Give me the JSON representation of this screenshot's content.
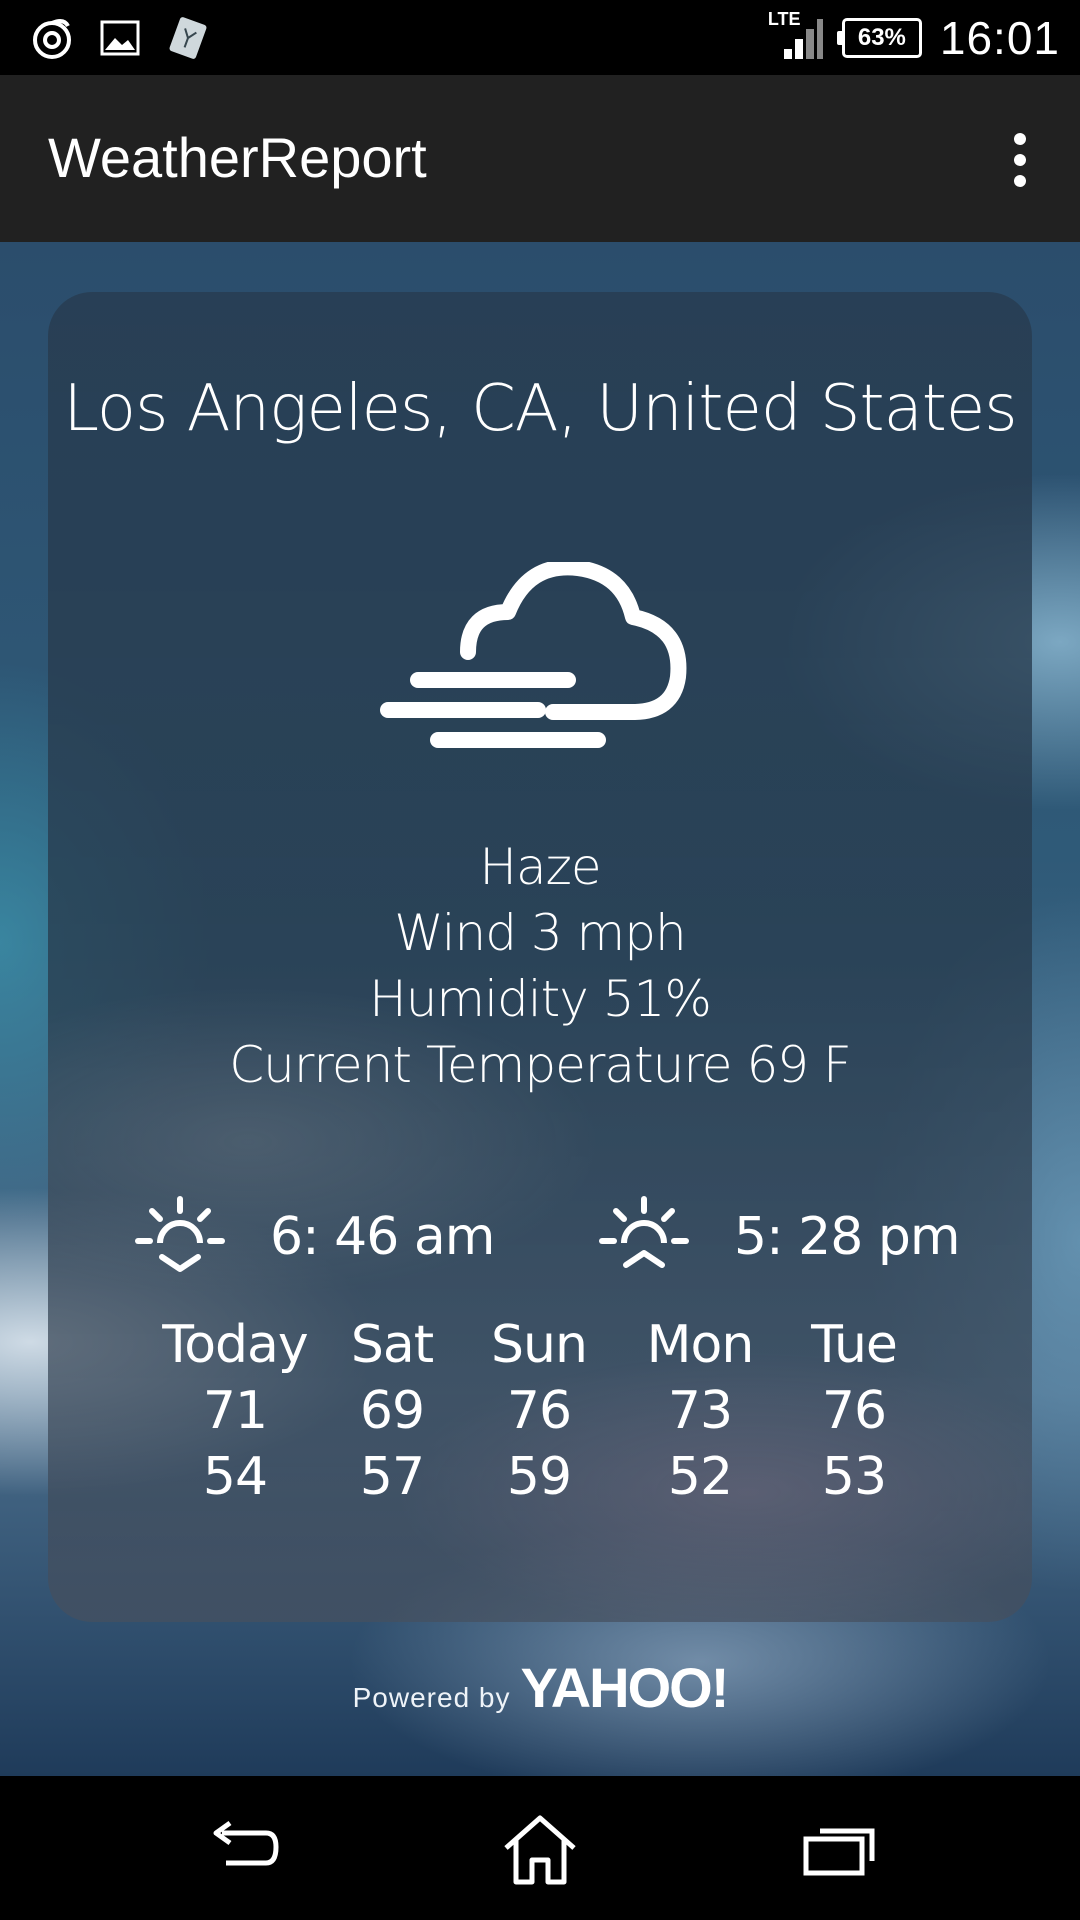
{
  "status_bar": {
    "icons": [
      "notification-swirl-icon",
      "image-icon",
      "sim-card-icon"
    ],
    "network": "LTE",
    "battery": "63%",
    "time": "16:01"
  },
  "app_bar": {
    "title": "WeatherReport",
    "menu_icon": "overflow-menu-icon"
  },
  "weather": {
    "location": "Los Angeles, CA, United States",
    "icon": "haze-cloud-icon",
    "condition": "Haze",
    "wind": "Wind 3 mph",
    "humidity": "Humidity  51%",
    "current_temp": "Current Temperature  69 F",
    "sunrise": "6: 46 am",
    "sunset": "5: 28 pm"
  },
  "forecast": [
    {
      "day": "Today",
      "high": "71",
      "low": "54"
    },
    {
      "day": "Sat",
      "high": "69",
      "low": "57"
    },
    {
      "day": "Sun",
      "high": "76",
      "low": "59"
    },
    {
      "day": "Mon",
      "high": "73",
      "low": "52"
    },
    {
      "day": "Tue",
      "high": "76",
      "low": "53"
    }
  ],
  "footer": {
    "powered_by": "Powered by",
    "brand": "YAHOO!"
  },
  "nav_bar": {
    "icons": [
      "back-icon",
      "home-icon",
      "recent-apps-icon"
    ]
  }
}
